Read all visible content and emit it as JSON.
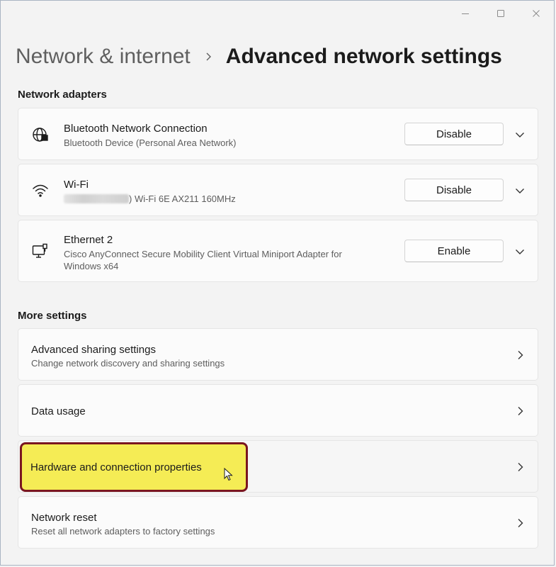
{
  "window": {
    "controls": [
      "minimize-icon",
      "maximize-icon",
      "close-icon"
    ]
  },
  "breadcrumb": {
    "parent": "Network & internet",
    "separator_icon": "chevron-right-icon",
    "current": "Advanced network settings"
  },
  "sections": {
    "adapters_label": "Network adapters",
    "more_label": "More settings"
  },
  "adapters": [
    {
      "icon": "globe-network-icon",
      "name": "Bluetooth Network Connection",
      "description": "Bluetooth Device (Personal Area Network)",
      "button": "Disable"
    },
    {
      "icon": "wifi-icon",
      "name": "Wi-Fi",
      "description_visible": ") Wi-Fi 6E AX211 160MHz",
      "button": "Disable"
    },
    {
      "icon": "ethernet-icon",
      "name": "Ethernet 2",
      "description": "Cisco AnyConnect Secure Mobility Client Virtual Miniport Adapter for Windows x64",
      "button": "Enable"
    }
  ],
  "more_settings": [
    {
      "title": "Advanced sharing settings",
      "description": "Change network discovery and sharing settings"
    },
    {
      "title": "Data usage"
    },
    {
      "title": "Hardware and connection properties",
      "highlighted": true
    },
    {
      "title": "Network reset",
      "description": "Reset all network adapters to factory settings"
    }
  ],
  "colors": {
    "background": "#f3f3f3",
    "card": "#fbfbfb",
    "highlight": "#f5ec55",
    "highlight_border": "#7a1620"
  }
}
